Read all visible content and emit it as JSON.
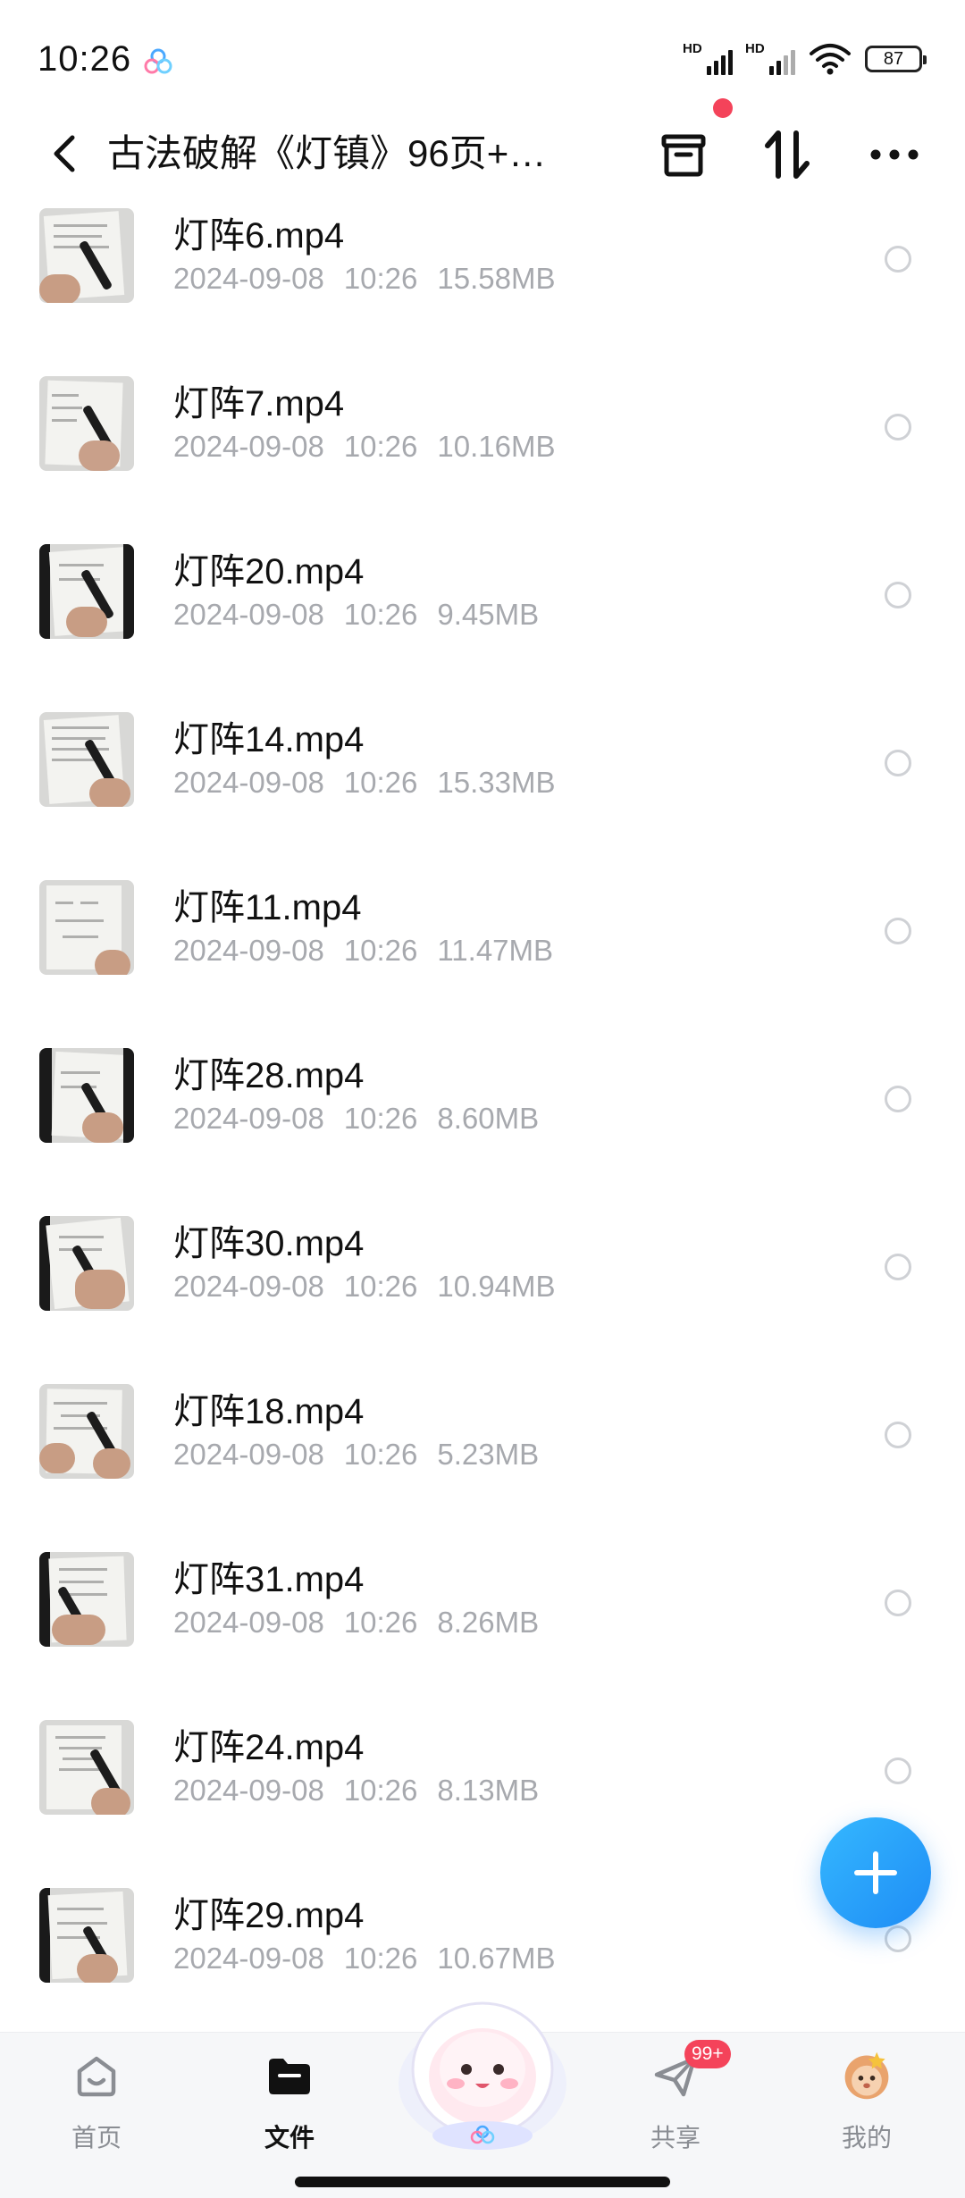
{
  "status_bar": {
    "time": "10:26",
    "battery": "87",
    "signal_labels": [
      "HD",
      "HD"
    ]
  },
  "header": {
    "title": "古法破解《灯镇》96页+…",
    "icons": [
      "back-arrow-icon",
      "archive-box-icon",
      "sort-icon",
      "more-dots-icon"
    ]
  },
  "files": [
    {
      "name": "灯阵6.mp4",
      "date": "2024-09-08",
      "time": "10:26",
      "size": "15.58MB"
    },
    {
      "name": "灯阵7.mp4",
      "date": "2024-09-08",
      "time": "10:26",
      "size": "10.16MB"
    },
    {
      "name": "灯阵20.mp4",
      "date": "2024-09-08",
      "time": "10:26",
      "size": "9.45MB"
    },
    {
      "name": "灯阵14.mp4",
      "date": "2024-09-08",
      "time": "10:26",
      "size": "15.33MB"
    },
    {
      "name": "灯阵11.mp4",
      "date": "2024-09-08",
      "time": "10:26",
      "size": "11.47MB"
    },
    {
      "name": "灯阵28.mp4",
      "date": "2024-09-08",
      "time": "10:26",
      "size": "8.60MB"
    },
    {
      "name": "灯阵30.mp4",
      "date": "2024-09-08",
      "time": "10:26",
      "size": "10.94MB"
    },
    {
      "name": "灯阵18.mp4",
      "date": "2024-09-08",
      "time": "10:26",
      "size": "5.23MB"
    },
    {
      "name": "灯阵31.mp4",
      "date": "2024-09-08",
      "time": "10:26",
      "size": "8.26MB"
    },
    {
      "name": "灯阵24.mp4",
      "date": "2024-09-08",
      "time": "10:26",
      "size": "8.13MB"
    },
    {
      "name": "灯阵29.mp4",
      "date": "2024-09-08",
      "time": "10:26",
      "size": "10.67MB"
    }
  ],
  "bottom_nav": {
    "home": "首页",
    "files": "文件",
    "share": "共享",
    "me": "我的",
    "share_badge": "99+"
  },
  "colors": {
    "accent": "#1e8cf5",
    "badge": "#f4435a",
    "meta_text": "#a7a9ae"
  }
}
